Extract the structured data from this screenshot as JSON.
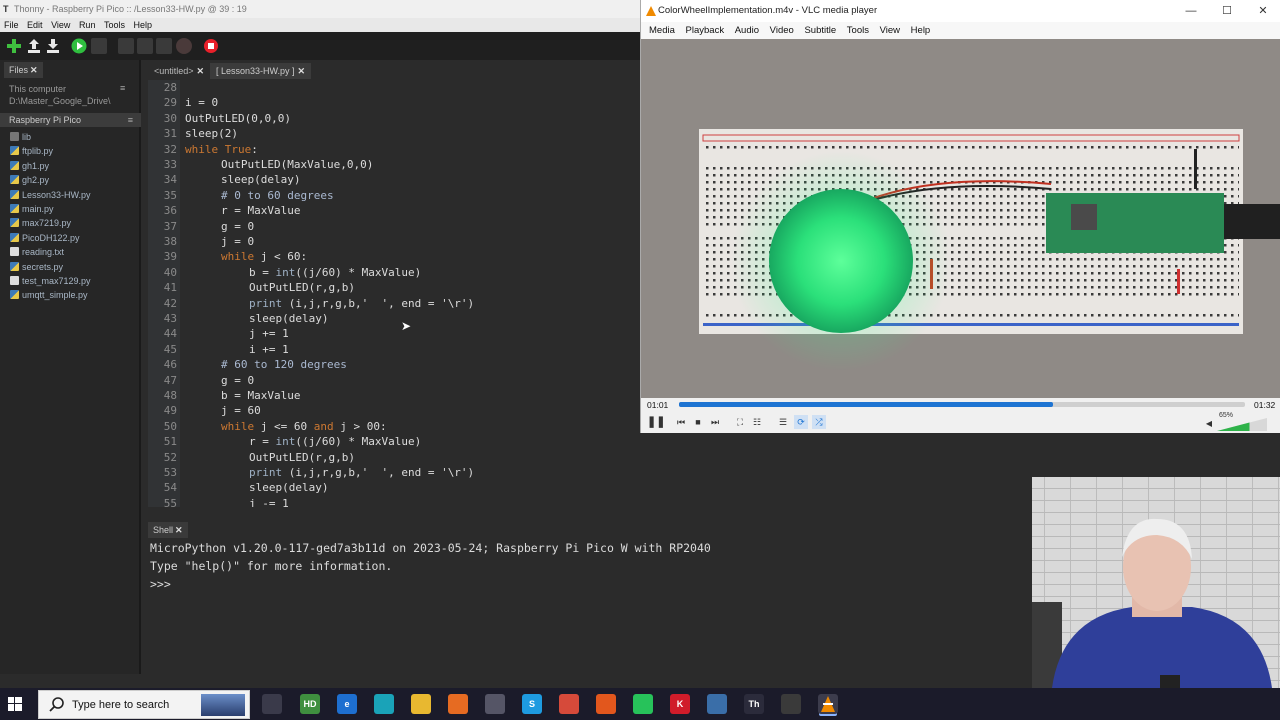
{
  "thonny": {
    "title": "Thonny  -  Raspberry Pi Pico :: /Lesson33-HW.py  @  39 : 19",
    "menu": [
      "File",
      "Edit",
      "View",
      "Run",
      "Tools",
      "Help"
    ],
    "files_tab": "Files",
    "this_computer_label": "This computer",
    "this_computer_path": "D:\\Master_Google_Drive\\",
    "pico_header": "Raspberry Pi Pico",
    "files": [
      {
        "name": "lib",
        "kind": "folder"
      },
      {
        "name": "ftplib.py",
        "kind": "py"
      },
      {
        "name": "gh1.py",
        "kind": "py"
      },
      {
        "name": "gh2.py",
        "kind": "py"
      },
      {
        "name": "Lesson33-HW.py",
        "kind": "py"
      },
      {
        "name": "main.py",
        "kind": "py"
      },
      {
        "name": "max7219.py",
        "kind": "py"
      },
      {
        "name": "PicoDH122.py",
        "kind": "py"
      },
      {
        "name": "reading.txt",
        "kind": "txt"
      },
      {
        "name": "secrets.py",
        "kind": "py"
      },
      {
        "name": "test_max7129.py",
        "kind": "txt"
      },
      {
        "name": "umqtt_simple.py",
        "kind": "py"
      }
    ],
    "editor_tabs": [
      "<untitled>",
      "[ Lesson33-HW.py ]"
    ],
    "code_lines": [
      {
        "n": "28",
        "indent": 0,
        "parts": []
      },
      {
        "n": "29",
        "indent": 0,
        "parts": [
          {
            "t": "i = 0",
            "c": ""
          }
        ]
      },
      {
        "n": "30",
        "indent": 0,
        "parts": [
          {
            "t": "OutPutLED(0,0,0)",
            "c": ""
          }
        ]
      },
      {
        "n": "31",
        "indent": 0,
        "parts": [
          {
            "t": "sleep(2)",
            "c": ""
          }
        ]
      },
      {
        "n": "32",
        "indent": 0,
        "parts": [
          {
            "t": "while True",
            "c": "kw"
          },
          {
            "t": ":",
            "c": ""
          }
        ]
      },
      {
        "n": "33",
        "indent": 1,
        "parts": [
          {
            "t": "OutPutLED(MaxValue,0,0)",
            "c": ""
          }
        ]
      },
      {
        "n": "34",
        "indent": 1,
        "parts": [
          {
            "t": "sleep(delay)",
            "c": ""
          }
        ]
      },
      {
        "n": "35",
        "indent": 1,
        "parts": [
          {
            "t": "# 0 to 60 degrees",
            "c": "cm"
          }
        ]
      },
      {
        "n": "36",
        "indent": 1,
        "parts": [
          {
            "t": "r = MaxValue",
            "c": ""
          }
        ]
      },
      {
        "n": "37",
        "indent": 1,
        "parts": [
          {
            "t": "g = 0",
            "c": ""
          }
        ]
      },
      {
        "n": "38",
        "indent": 1,
        "parts": [
          {
            "t": "j = 0",
            "c": ""
          }
        ]
      },
      {
        "n": "39",
        "indent": 1,
        "parts": [
          {
            "t": "while",
            "c": "kw"
          },
          {
            "t": " j < 60:",
            "c": ""
          }
        ]
      },
      {
        "n": "40",
        "indent": 2,
        "parts": [
          {
            "t": "b = ",
            "c": ""
          },
          {
            "t": "int",
            "c": "fn"
          },
          {
            "t": "((j/60) * MaxValue)",
            "c": ""
          }
        ]
      },
      {
        "n": "41",
        "indent": 2,
        "parts": [
          {
            "t": "OutPutLED(r,g,b)",
            "c": ""
          }
        ]
      },
      {
        "n": "42",
        "indent": 2,
        "parts": [
          {
            "t": "print",
            "c": "fn"
          },
          {
            "t": " (i,j,r,g,b,'  ', end = '\\r')",
            "c": ""
          }
        ]
      },
      {
        "n": "43",
        "indent": 2,
        "parts": [
          {
            "t": "sleep(delay)",
            "c": ""
          }
        ]
      },
      {
        "n": "44",
        "indent": 2,
        "parts": [
          {
            "t": "j += 1",
            "c": ""
          }
        ]
      },
      {
        "n": "45",
        "indent": 2,
        "parts": [
          {
            "t": "i += 1",
            "c": ""
          }
        ]
      },
      {
        "n": "46",
        "indent": 1,
        "parts": [
          {
            "t": "# 60 to 120 degrees",
            "c": "cm"
          }
        ]
      },
      {
        "n": "47",
        "indent": 1,
        "parts": [
          {
            "t": "g = 0",
            "c": ""
          }
        ]
      },
      {
        "n": "48",
        "indent": 1,
        "parts": [
          {
            "t": "b = MaxValue",
            "c": ""
          }
        ]
      },
      {
        "n": "49",
        "indent": 1,
        "parts": [
          {
            "t": "j = 60",
            "c": ""
          }
        ]
      },
      {
        "n": "50",
        "indent": 1,
        "parts": [
          {
            "t": "while",
            "c": "kw"
          },
          {
            "t": " j <= 60 ",
            "c": ""
          },
          {
            "t": "and",
            "c": "kw"
          },
          {
            "t": " j > 00:",
            "c": ""
          }
        ]
      },
      {
        "n": "51",
        "indent": 2,
        "parts": [
          {
            "t": "r = ",
            "c": ""
          },
          {
            "t": "int",
            "c": "fn"
          },
          {
            "t": "((j/60) * MaxValue)",
            "c": ""
          }
        ]
      },
      {
        "n": "52",
        "indent": 2,
        "parts": [
          {
            "t": "OutPutLED(r,g,b)",
            "c": ""
          }
        ]
      },
      {
        "n": "53",
        "indent": 2,
        "parts": [
          {
            "t": "print",
            "c": "fn"
          },
          {
            "t": " (i,j,r,g,b,'  ', end = '\\r')",
            "c": ""
          }
        ]
      },
      {
        "n": "54",
        "indent": 2,
        "parts": [
          {
            "t": "sleep(delay)",
            "c": ""
          }
        ]
      },
      {
        "n": "55",
        "indent": 2,
        "parts": [
          {
            "t": "j -= 1",
            "c": ""
          }
        ]
      }
    ],
    "shell_tab": "Shell",
    "shell_lines": [
      "MicroPython v1.20.0-117-ged7a3b11d on 2023-05-24; Raspberry Pi Pico W with RP2040",
      "Type \"help()\" for more information.",
      ">>>"
    ]
  },
  "vlc": {
    "title": "ColorWheelImplementation.m4v - VLC media player",
    "menu": [
      "Media",
      "Playback",
      "Audio",
      "Video",
      "Subtitle",
      "Tools",
      "View",
      "Help"
    ],
    "elapsed": "01:01",
    "total": "01:32",
    "progress_fraction": 0.66,
    "volume_label": "65%",
    "volume_fraction": 0.65
  },
  "taskbar": {
    "search_placeholder": "Type here to search",
    "icons": [
      {
        "name": "task-view-icon",
        "label": "",
        "color": "#3a3a4a"
      },
      {
        "name": "hd-app-icon",
        "label": "HD",
        "color": "#3f8f3f"
      },
      {
        "name": "edge-legacy-icon",
        "label": "e",
        "color": "#1e6fd0"
      },
      {
        "name": "edge-icon",
        "label": "",
        "color": "#1aa3b8"
      },
      {
        "name": "file-explorer-icon",
        "label": "",
        "color": "#e8b830"
      },
      {
        "name": "firefox-icon",
        "label": "",
        "color": "#e66b22"
      },
      {
        "name": "calculator-icon",
        "label": "",
        "color": "#555566"
      },
      {
        "name": "skype-icon",
        "label": "S",
        "color": "#1e9be0"
      },
      {
        "name": "chrome-icon",
        "label": "",
        "color": "#d64a3a"
      },
      {
        "name": "brave-icon",
        "label": "",
        "color": "#e2571d"
      },
      {
        "name": "whatsapp-icon",
        "label": "",
        "color": "#27c25a"
      },
      {
        "name": "k-app-icon",
        "label": "K",
        "color": "#d01c2a"
      },
      {
        "name": "network-app-icon",
        "label": "",
        "color": "#3a6ea8"
      },
      {
        "name": "thonny-taskbar-icon",
        "label": "Th",
        "color": "#2b2b3b"
      },
      {
        "name": "obs-icon",
        "label": "",
        "color": "#3a3a3a"
      },
      {
        "name": "vlc-taskbar-icon",
        "label": "",
        "color": "#3c3c4c"
      }
    ]
  }
}
